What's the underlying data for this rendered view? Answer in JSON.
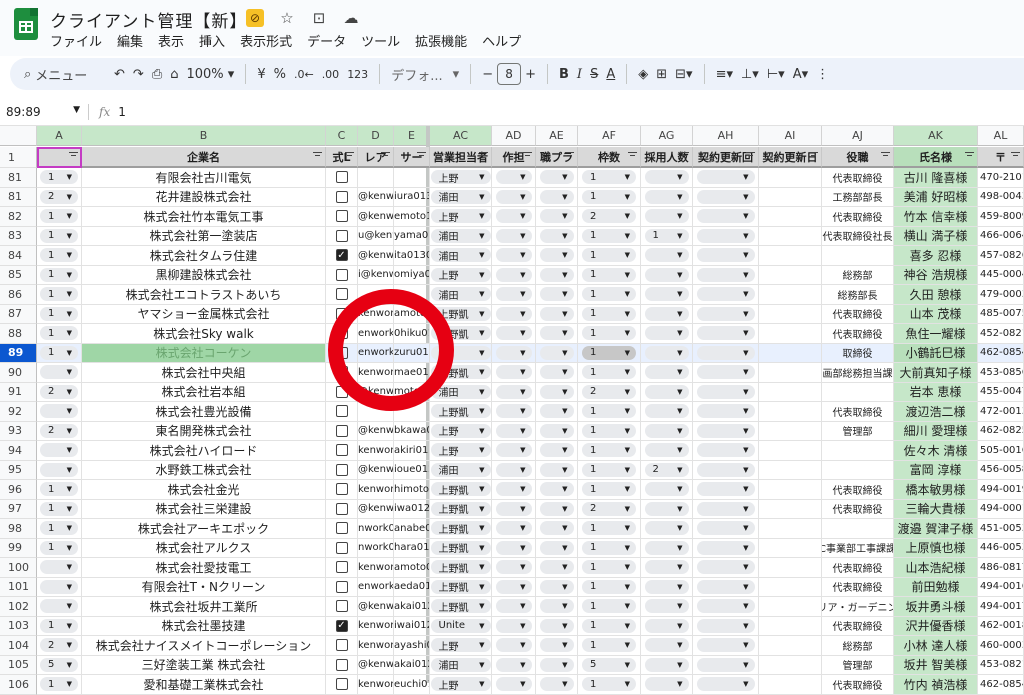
{
  "title": "クライアント管理【新】",
  "menu": [
    "ファイル",
    "編集",
    "表示",
    "挿入",
    "表示形式",
    "データ",
    "ツール",
    "拡張機能",
    "ヘルプ"
  ],
  "toolbar": {
    "search_label": "メニュー",
    "zoom": "100%",
    "currency": "¥",
    "percent": "%",
    "dec_less": ".0←",
    "dec_more": ".00",
    "num_format": "123",
    "font": "デフォ...",
    "font_size": "8",
    "bold": "B",
    "italic": "I",
    "strike": "S",
    "text_color": "A"
  },
  "name_box": "89:89",
  "formula_value": "1",
  "columns": [
    "A",
    "B",
    "C",
    "D",
    "E",
    "AC",
    "AD",
    "AE",
    "AF",
    "AG",
    "AH",
    "AI",
    "AJ",
    "AK",
    "AL"
  ],
  "header_row": {
    "num": "1",
    "cells": [
      "",
      "企業名",
      "式L",
      "レア",
      "サー",
      "営業担当者",
      "作担",
      "職プラ",
      "枠数",
      "採用人数",
      "契約更新回",
      "契約更新日",
      "役職",
      "氏名様",
      "〒"
    ]
  },
  "rows": [
    {
      "n": "81",
      "a": "1",
      "b": "有限会社古川電気",
      "d": "",
      "e": "",
      "ac": "上野",
      "af": "1",
      "ag": "",
      "aj": "代表取締役",
      "ak": "古川 隆喜様",
      "al": "470-2101",
      "cb": false
    },
    {
      "n": "81",
      "a": "2",
      "b": "花井建設株式会社",
      "d": "@kenwo",
      "e": "iura013",
      "ac": "浦田",
      "af": "1",
      "ag": "",
      "aj": "工務部部長",
      "ak": "美浦 好昭様",
      "al": "498-0043",
      "cb": false
    },
    {
      "n": "82",
      "a": "1",
      "b": "株式会社竹本電気工事",
      "d": "@kenwo",
      "e": "emoto1",
      "ac": "上野",
      "af": "2",
      "ag": "",
      "aj": "代表取締役",
      "ak": "竹本 信幸様",
      "al": "459-8009",
      "cb": false
    },
    {
      "n": "83",
      "a": "1",
      "b": "株式会社第一塗装店",
      "d": "u@kenwo",
      "e": "yama0",
      "ac": "浦田",
      "af": "1",
      "ag": "1",
      "aj": "代表取締役社長",
      "ak": "横山 満子様",
      "al": "466-0064",
      "cb": false
    },
    {
      "n": "84",
      "a": "1",
      "b": "株式会社タムラ住建",
      "d": "@kenwo",
      "e": "ita0130",
      "ac": "浦田",
      "af": "1",
      "ag": "",
      "aj": "",
      "ak": "喜多 忍様",
      "al": "457-0826",
      "cb": true
    },
    {
      "n": "85",
      "a": "1",
      "b": "黒柳建設株式会社",
      "d": "i@kenw",
      "e": "omiya01",
      "ac": "上野",
      "af": "1",
      "ag": "",
      "aj": "総務部",
      "ak": "神谷 浩規様",
      "al": "445-0004",
      "cb": false
    },
    {
      "n": "86",
      "a": "1",
      "b": "株式会社エコトラストあいち",
      "d": "",
      "e": "",
      "ac": "浦田",
      "af": "1",
      "ag": "",
      "aj": "総務部長",
      "ak": "久田 憩様",
      "al": "479-0003",
      "cb": false
    },
    {
      "n": "87",
      "a": "1",
      "b": "ヤマショー金属株式会社",
      "d": "kenwork",
      "e": "amoto0",
      "ac": "上野凱",
      "af": "1",
      "ag": "",
      "aj": "代表取締役",
      "ak": "山本 茂様",
      "al": "485-0075",
      "cb": false
    },
    {
      "n": "88",
      "a": "1",
      "b": "株式会社Sky walk",
      "d": "enwork",
      "e": "0hiku01",
      "ac": "上野凱",
      "af": "1",
      "ag": "",
      "aj": "代表取締役",
      "ak": "魚住一耀様",
      "al": "452-0821",
      "cb": false
    },
    {
      "n": "89",
      "a": "1",
      "b": "株式会社コーケン",
      "d": "enwork0",
      "e": "zuru01",
      "ac": "",
      "af": "1",
      "ag": "",
      "aj": "取締役",
      "ak": "小鶴託巳様",
      "al": "462-0854",
      "cb": false,
      "sel": true
    },
    {
      "n": "90",
      "a": "",
      "b": "株式会社中央組",
      "d": "kenwork",
      "e": "mae01",
      "ac": "上野凱",
      "af": "1",
      "ag": "",
      "aj": "画部総務担当課",
      "ak": "大前真知子様",
      "al": "453-0856",
      "cb": false
    },
    {
      "n": "91",
      "a": "2",
      "b": "株式会社岩本組",
      "d": "@kenwo",
      "e": "moto01",
      "ac": "浦田",
      "af": "2",
      "ag": "",
      "aj": "",
      "ak": "岩本 恵様",
      "al": "455-0047",
      "cb": false
    },
    {
      "n": "92",
      "a": "",
      "b": "株式会社豊光設備",
      "d": "",
      "e": "",
      "ac": "上野凱",
      "af": "1",
      "ag": "",
      "aj": "代表取締役",
      "ak": "渡辺浩二様",
      "al": "472-0013",
      "cb": false
    },
    {
      "n": "93",
      "a": "2",
      "b": "東名開発株式会社",
      "d": "@kenwo",
      "e": "bkawa0",
      "ac": "上野",
      "af": "1",
      "ag": "",
      "aj": "管理部",
      "ak": "細川 愛理様",
      "al": "462-0825",
      "cb": false
    },
    {
      "n": "94",
      "a": "",
      "b": "株式会社ハイロード",
      "d": "kenwork",
      "e": "akiri012",
      "ac": "上野",
      "af": "1",
      "ag": "",
      "aj": "",
      "ak": "佐々木 清様",
      "al": "505-0016",
      "cb": false
    },
    {
      "n": "95",
      "a": "",
      "b": "水野鉄工株式会社",
      "d": "@kenwo",
      "e": "ioue012",
      "ac": "浦田",
      "af": "1",
      "ag": "2",
      "aj": "",
      "ak": "富岡 淳様",
      "al": "456-0058",
      "cb": false
    },
    {
      "n": "96",
      "a": "1",
      "b": "株式会社金光",
      "d": "kenwork",
      "e": "himoto0",
      "ac": "上野凱",
      "af": "1",
      "ag": "",
      "aj": "代表取締役",
      "ak": "橋本敏男様",
      "al": "494-0019",
      "cb": false
    },
    {
      "n": "97",
      "a": "1",
      "b": "株式会社三栄建設",
      "d": "@kenw",
      "e": "iwa012",
      "ac": "上野凱",
      "af": "2",
      "ag": "",
      "aj": "代表取締役",
      "ak": "三輪大貴様",
      "al": "494-0001",
      "cb": false
    },
    {
      "n": "98",
      "a": "1",
      "b": "株式会社アーキエポック",
      "d": "nwork0",
      "e": "anabe0",
      "ac": "上野凱",
      "af": "1",
      "ag": "",
      "aj": "",
      "ak": "渡邉 賀津子様",
      "al": "451-0053",
      "cb": false
    },
    {
      "n": "99",
      "a": "1",
      "b": "株式会社アルクス",
      "d": "nwork08",
      "e": "hara01",
      "ac": "上野凱",
      "af": "1",
      "ag": "",
      "aj": "C事業部工事課課",
      "ak": "上原慎也様",
      "al": "446-0053",
      "cb": false
    },
    {
      "n": "100",
      "a": "",
      "b": "株式会社愛技電工",
      "d": "kenwork",
      "e": "amoto0",
      "ac": "上野凱",
      "af": "1",
      "ag": "",
      "aj": "代表取締役",
      "ak": "山本浩紀様",
      "al": "486-0817",
      "cb": false
    },
    {
      "n": "101",
      "a": "",
      "b": "有限会社T・Nクリーン",
      "d": "enwork",
      "e": "aeda01",
      "ac": "上野凱",
      "af": "1",
      "ag": "",
      "aj": "代表取締役",
      "ak": "前田勉様",
      "al": "494-0016",
      "cb": false
    },
    {
      "n": "102",
      "a": "",
      "b": "株式会社坂井工業所",
      "d": "@kenwo",
      "e": "akai012",
      "ac": "上野凱",
      "af": "1",
      "ag": "",
      "aj": "リア・ガーデニン",
      "ak": "坂井勇斗様",
      "al": "494-0017",
      "cb": false
    },
    {
      "n": "103",
      "a": "1",
      "b": "株式会社墨技建",
      "d": "kenwor",
      "e": "iwai012",
      "ac": "Unite",
      "af": "1",
      "ag": "",
      "aj": "代表取締役",
      "ak": "沢井優香様",
      "al": "462-0018",
      "cb": true
    },
    {
      "n": "104",
      "a": "2",
      "b": "株式会社ナイスメイトコーポレーション",
      "d": "kenwork",
      "e": "ayashi0",
      "ac": "上野",
      "af": "1",
      "ag": "",
      "aj": "総務部",
      "ak": "小林 達人様",
      "al": "460-0003",
      "cb": false
    },
    {
      "n": "105",
      "a": "5",
      "b": "三好塗装工業 株式会社",
      "d": "@kenwo",
      "e": "akai012",
      "ac": "浦田",
      "af": "5",
      "ag": "",
      "aj": "管理部",
      "ak": "坂井 智美様",
      "al": "453-0821",
      "cb": false
    },
    {
      "n": "106",
      "a": "1",
      "b": "愛和基礎工業株式会社",
      "d": "kenwork",
      "e": "euchi01",
      "ac": "上野",
      "af": "1",
      "ag": "",
      "aj": "代表取締役",
      "ak": "竹内 禎浩様",
      "al": "462-0854",
      "cb": false
    }
  ],
  "colors": {
    "accent_blue": "#0b57d0",
    "green_header": "#c6e7c9",
    "annotation_red": "#e60012"
  }
}
